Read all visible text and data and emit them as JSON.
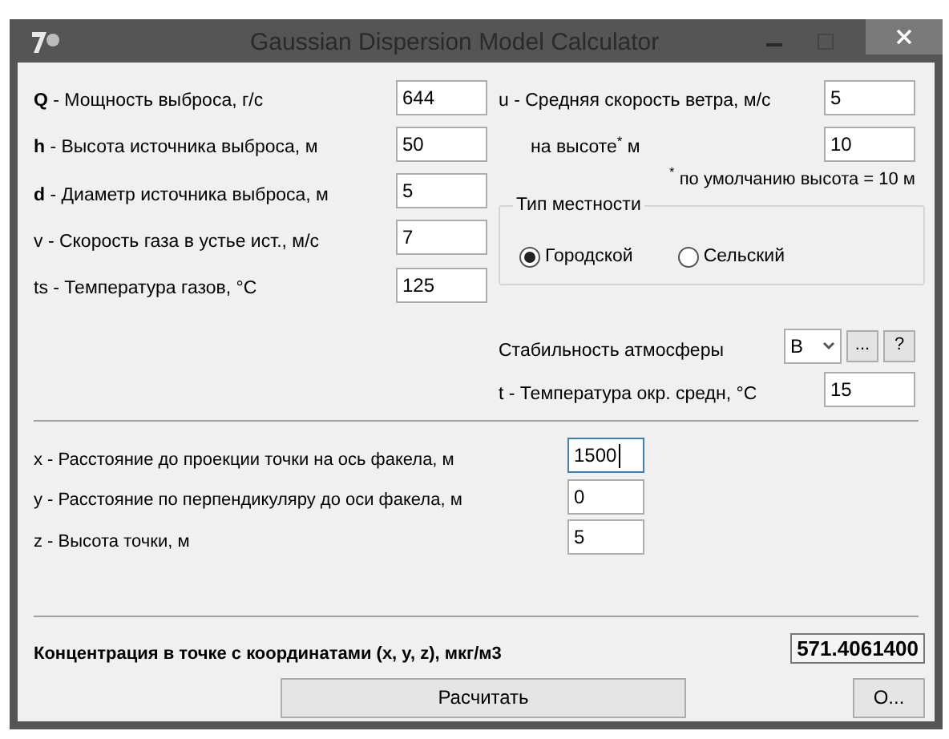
{
  "window": {
    "title": "Gaussian Dispersion Model Calculator"
  },
  "source_params": [
    {
      "label": "**Q** - Мощность выброса, г/с",
      "value": "644"
    },
    {
      "label": "**h** - Высота источника выброса, м",
      "value": "50"
    },
    {
      "label": "**d** - Диаметр источника выброса, м",
      "value": "5"
    },
    {
      "label": "v - Скорость газа в устье ист., м/с",
      "value": "7"
    },
    {
      "label": "ts - Температура газов, °C",
      "value": "125"
    }
  ],
  "wind": {
    "label": "u - Средняя скорость ветра, м/с",
    "value": "5"
  },
  "wind_height": {
    "label": "на высоте$^{*}$ м",
    "value": "10"
  },
  "footnote": "$^{*}$ по умолчанию высота = 10 м",
  "terrain": {
    "title": "Тип местности",
    "options": [
      {
        "label": "Городской",
        "selected": true
      },
      {
        "label": "Сельский",
        "selected": false
      }
    ]
  },
  "stability": {
    "label": "Стабильность атмосферы",
    "value": "B",
    "buttons": [
      "...",
      "?"
    ]
  },
  "ambient": {
    "label": "t - Температура окр. средн, °C",
    "value": "15"
  },
  "point": [
    {
      "label": "x - Расстояние до проекции точки на ось факела, м",
      "value": "1500",
      "focused": true
    },
    {
      "label": "y - Расстояние по перпендикуляру до оси факела, м",
      "value": "0",
      "focused": false
    },
    {
      "label": "z - Высота точки, м",
      "value": "5",
      "focused": false
    }
  ],
  "result": {
    "label": "Концентрация в точке с координатами (x, y, z), мкг/м3",
    "value": "571.4061400"
  },
  "buttons": [
    "Расчитать",
    "О..."
  ]
}
